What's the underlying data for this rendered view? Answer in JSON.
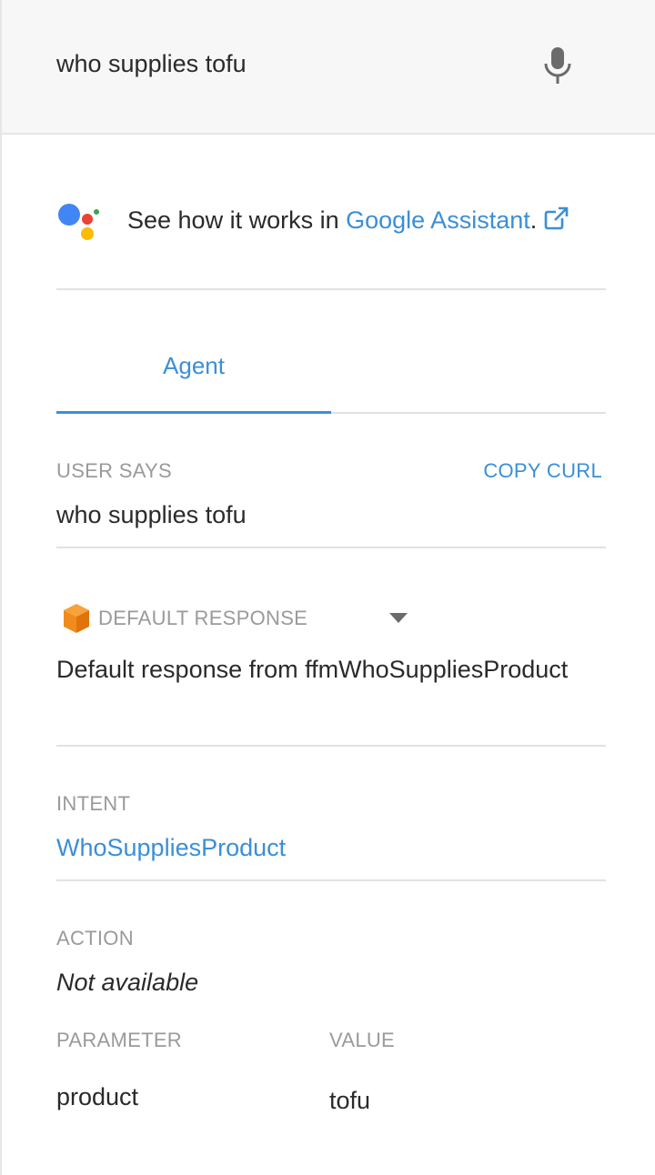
{
  "query": {
    "text": "who supplies tofu",
    "mic_icon": "microphone-icon"
  },
  "assistant": {
    "prefix": "See how it works in ",
    "link_text": "Google Assistant",
    "suffix": ".",
    "logo_icon": "google-assistant-logo",
    "external_icon": "external-link-icon"
  },
  "tabs": [
    {
      "label": "Agent",
      "active": true
    }
  ],
  "user_says": {
    "label": "USER SAYS",
    "copy_label": "COPY CURL",
    "value": "who supplies tofu"
  },
  "default_response": {
    "label": "DEFAULT RESPONSE",
    "icon": "cube-icon",
    "value": "Default response from ffmWhoSuppliesProduct"
  },
  "intent": {
    "label": "INTENT",
    "value": "WhoSuppliesProduct"
  },
  "action": {
    "label": "ACTION",
    "value": "Not available"
  },
  "parameters": {
    "param_header": "PARAMETER",
    "value_header": "VALUE",
    "rows": [
      {
        "parameter": "product",
        "value": "tofu"
      }
    ]
  },
  "colors": {
    "accent": "#3a8fd8",
    "label_gray": "#9a9a9a",
    "query_bar_bg": "#f7f7f7"
  }
}
